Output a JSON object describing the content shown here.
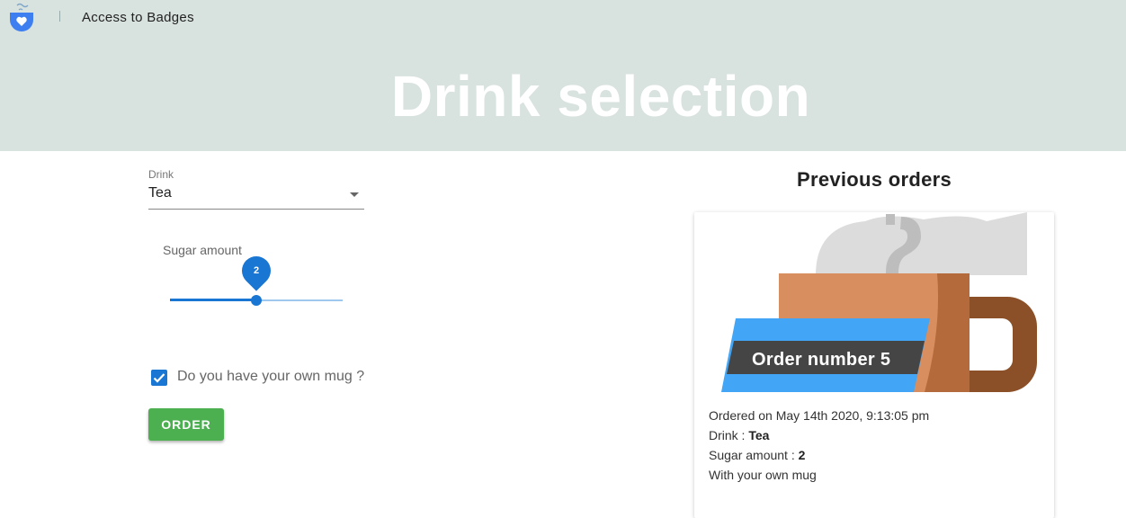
{
  "header": {
    "brand_link": "Access to Badges",
    "hero_title": "Drink selection"
  },
  "form": {
    "drink_label": "Drink",
    "drink_value": "Tea",
    "sugar_label": "Sugar amount",
    "sugar_value": "2",
    "sugar_fraction": 0.5,
    "mug_checked": true,
    "mug_label": "Do you have your own mug ?",
    "order_button": "ORDER"
  },
  "previous_orders": {
    "title": "Previous orders",
    "card": {
      "order_number": "Order number 5",
      "ordered_on": "Ordered on May 14th 2020, 9:13:05 pm",
      "drink_prefix": "Drink : ",
      "drink_value": "Tea",
      "sugar_prefix": "Sugar amount : ",
      "sugar_value": "2",
      "mug_text": "With your own mug"
    }
  },
  "colors": {
    "header_bg": "#d8e2df",
    "accent": "#1976d2",
    "order_button": "#4caf50",
    "ribbon": "#42a5f5",
    "ribbon_dark": "#454545",
    "mug": "#d98e5f",
    "mug_handle": "#8b5027"
  },
  "icons": {
    "logo": "coffee-heart-logo-icon",
    "dropdown": "chevron-down-icon",
    "checkbox": "checkmark-icon"
  }
}
